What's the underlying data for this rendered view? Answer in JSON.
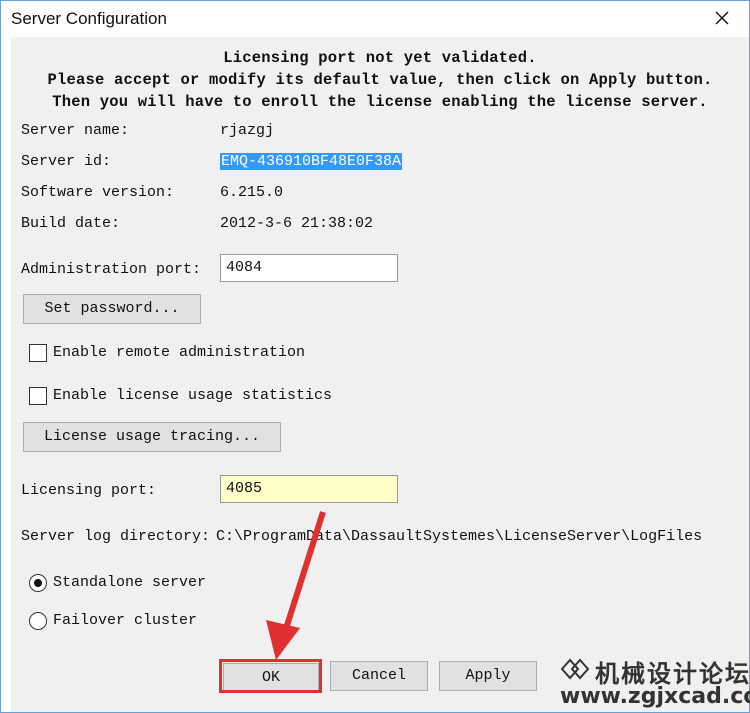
{
  "window": {
    "title": "Server Configuration"
  },
  "notice": {
    "line1": "Licensing port not yet validated.",
    "line2": "Please accept or modify its default value, then click on Apply button.",
    "line3": "Then you will have to enroll the license enabling the license server."
  },
  "info": {
    "server_name_label": "Server name:",
    "server_name_value": "rjazgj",
    "server_id_label": "Server id:",
    "server_id_value": "EMQ-436910BF48E0F38A",
    "software_version_label": "Software version:",
    "software_version_value": "6.215.0",
    "build_date_label": "Build date:",
    "build_date_value": "2012-3-6 21:38:02"
  },
  "admin": {
    "port_label": "Administration port:",
    "port_value": "4084",
    "set_password_label": "Set password...",
    "enable_remote_label": "Enable remote administration",
    "enable_remote_checked": false,
    "enable_stats_label": "Enable license usage statistics",
    "enable_stats_checked": false,
    "tracing_label": "License usage tracing..."
  },
  "licensing": {
    "port_label": "Licensing port:",
    "port_value": "4085",
    "log_dir_label": "Server log directory:",
    "log_dir_value": "C:\\ProgramData\\DassaultSystemes\\LicenseServer\\LogFiles"
  },
  "mode": {
    "standalone_label": "Standalone server",
    "failover_label": "Failover cluster",
    "selected": "standalone"
  },
  "buttons": {
    "ok": "OK",
    "cancel": "Cancel",
    "apply": "Apply"
  },
  "watermark": {
    "line1": "机械设计论坛",
    "line2": "www.zgjxcad.com"
  },
  "colors": {
    "selection": "#3399ff",
    "highlight": "#e03030",
    "yellow_field": "#ffffc8"
  }
}
